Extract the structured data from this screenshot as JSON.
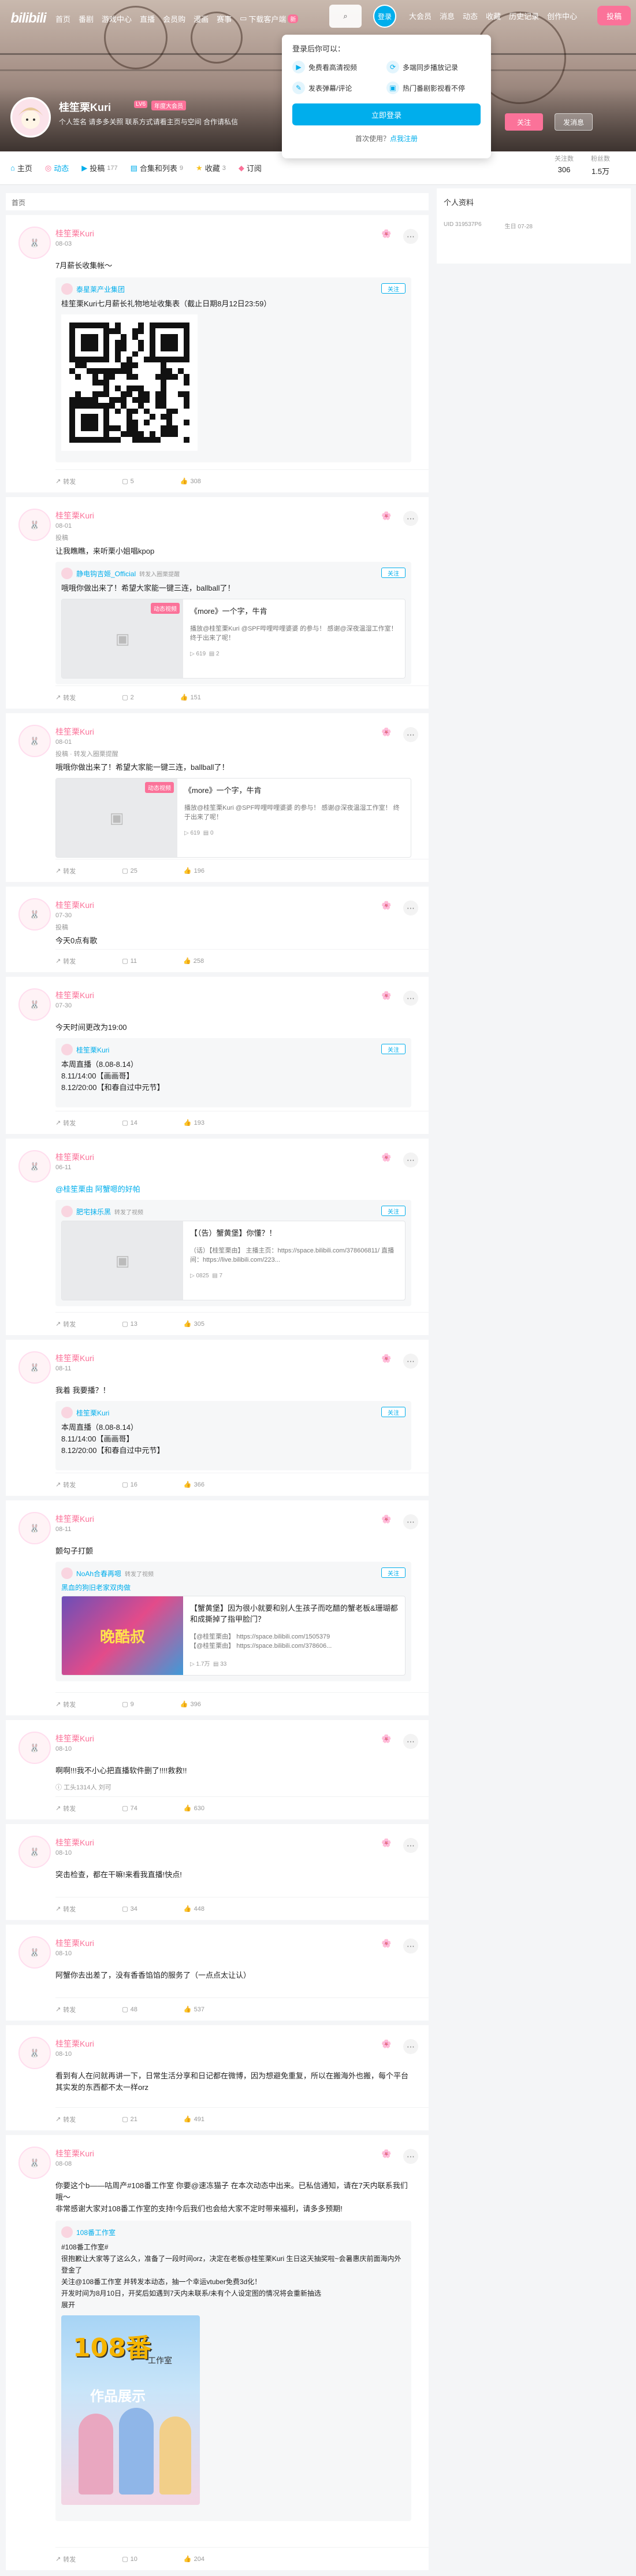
{
  "header": {
    "logo": "bilibili",
    "nav": [
      "首页",
      "番剧",
      "游戏中心",
      "直播",
      "会员购",
      "漫画",
      "赛事"
    ],
    "download": "下载客户端",
    "download_badge": "新",
    "login": "登录",
    "right_nav": [
      "大会员",
      "消息",
      "动态",
      "收藏",
      "历史记录",
      "创作中心"
    ],
    "post": "投稿"
  },
  "profile": {
    "name": "桂笙栗Kuri",
    "level": "LV6",
    "vip": "年度大会员",
    "sign": "个人签名 请多多关照 联系方式请看主页与空间 合作请私信",
    "follow": "关注",
    "message": "发消息",
    "stats": [
      {
        "label": "关注数",
        "value": "306"
      },
      {
        "label": "粉丝数",
        "value": "1.5万"
      }
    ]
  },
  "login_popup": {
    "title": "登录后你可以：",
    "features": [
      "免费看高清视频",
      "多端同步播放记录",
      "发表弹幕/评论",
      "热门番剧影视看不停"
    ],
    "button": "立即登录",
    "first_prefix": "首次使用？",
    "first_link": "点我注册"
  },
  "tabs": [
    {
      "label": "主页",
      "count": ""
    },
    {
      "label": "动态",
      "count": ""
    },
    {
      "label": "投稿",
      "count": "177"
    },
    {
      "label": "合集和列表",
      "count": "9"
    },
    {
      "label": "收藏",
      "count": "3"
    },
    {
      "label": "订阅",
      "count": ""
    }
  ],
  "breadcrumb": "首页",
  "side": {
    "title": "个人资料",
    "uid": "UID 319537P6",
    "birth": "生日 07-28"
  },
  "cards": [
    {
      "name": "桂笙栗Kuri",
      "date": "08-03",
      "text": "7月薪长收集帐～",
      "quote_name": "泰星莱产业集团",
      "quote_btn": "关注",
      "quote_text": "桂笙栗Kuri七月薪长礼物地址收集表（截止日期8月12日23:59）",
      "actions": [
        "转发",
        "5",
        "308"
      ]
    },
    {
      "name": "桂笙栗Kuri",
      "date": "08-01",
      "sub": "投稿",
      "text": "让我瞧瞧，来听栗小姐唱kpop",
      "quote_name": "静电钩吉姬_Official",
      "quote_note": "转发入圈栗提醒",
      "quote_btn": "关注",
      "quote_text": "哦哦你做出来了！希望大家能一键三连，ballball了！",
      "vtag": "动态视频",
      "vtitle": "《more》一个字，牛肯",
      "vdesc": "播放@桂笙栗Kuri @SPF哔哩哔哩婆婆 的参与！ 感谢@深夜温湿工作室！ 终于出来了呢！",
      "vstats": [
        "619",
        "2"
      ],
      "actions": [
        "转发",
        "2",
        "151"
      ]
    },
    {
      "name": "桂笙栗Kuri",
      "date": "08-01",
      "sub": "投稿 · 转发入圈栗提醒",
      "text": "哦哦你做出来了！希望大家能一键三连，ballball了！",
      "vtag": "动态视频",
      "vtitle": "《more》一个字，牛肯",
      "vdesc": "播放@桂笙栗Kuri @SPF哔哩哔哩婆婆 的参与！ 感谢@深夜温湿工作室！ 终于出来了呢！",
      "vstats": [
        "619",
        "0"
      ],
      "actions": [
        "转发",
        "25",
        "196"
      ]
    },
    {
      "name": "桂笙栗Kuri",
      "date": "07-30",
      "sub": "投稿",
      "text": "今天0点有歌",
      "actions": [
        "转发",
        "11",
        "258"
      ]
    },
    {
      "name": "桂笙栗Kuri",
      "date": "07-30",
      "text": "今天时间更改为19:00",
      "quote_name": "桂笙栗Kuri",
      "quote_btn": "关注",
      "quote_text": "本周直播（8.08-8.14）\n8.11/14:00【画画哥】\n8.12/20:00【和春自过中元节】",
      "actions": [
        "转发",
        "14",
        "193"
      ]
    },
    {
      "name": "桂笙栗Kuri",
      "date": "06-11",
      "text": "@桂笙栗由 阿蟹嗯的好帕",
      "quote_name": "肥宅抹乐黑",
      "quote_note": "转发了视频",
      "quote_btn": "关注",
      "vtitle": "【（告）蟹黄堡】你懂？！",
      "vdesc": "（话）【桂笙栗由】 主播主页：https://space.bilibili.com/378606811/ 直播间：https://live.bilibili.com/223...",
      "vstats": [
        "0825",
        "7"
      ],
      "actions": [
        "转发",
        "13",
        "305"
      ]
    },
    {
      "name": "桂笙栗Kuri",
      "date": "08-11",
      "text": "我着 我要播？！",
      "quote_name": "桂笙栗Kuri",
      "quote_btn": "关注",
      "quote_text": "本周直播（8.08-8.14）\n8.11/14:00【画画哥】\n8.12/20:00【和春自过中元节】",
      "actions": [
        "转发",
        "16",
        "366"
      ]
    },
    {
      "name": "桂笙栗Kuri",
      "date": "08-11",
      "text": "颤勾子打颤",
      "quote_name": "NoAh合春再嗯",
      "quote_note": "转发了视频",
      "quote_btn": "关注",
      "quote_sub": "黑血的狗旧老家双肉做",
      "vtitle": "【蟹黄堡】因为很小就要和别人生孩子而吃醋的蟹老板&珊瑚都和成撕掉了指甲脸门？",
      "vdesc": "【@桂笙栗由】 https://space.bilibili.com/1505379\n【@桂笙栗由】 https://space.bilibili.com/378606...",
      "vthumb_text": "晚酷叔",
      "vstats": [
        "1.7万",
        "33"
      ],
      "actions": [
        "转发",
        "9",
        "396"
      ]
    },
    {
      "name": "桂笙栗Kuri",
      "date": "08-10",
      "text": "啊啊!!!我不小心把直播软件删了!!!!救救!!",
      "note": "工头1314人 刘可",
      "actions": [
        "转发",
        "74",
        "630"
      ]
    },
    {
      "name": "桂笙栗Kuri",
      "date": "08-10",
      "text": "突击检查，都在干嘛!来看我直播!快点!",
      "actions": [
        "转发",
        "34",
        "448"
      ]
    },
    {
      "name": "桂笙栗Kuri",
      "date": "08-10",
      "text": "阿蟹你去出差了，没有香香馅馅的服务了（一点点太让认）",
      "actions": [
        "转发",
        "48",
        "537"
      ]
    },
    {
      "name": "桂笙栗Kuri",
      "date": "08-10",
      "text": "看到有人在问就再讲一下，日常生活分享和日记都在微博，因为想避免重复，所以在搬海外也搬，每个平台其实发的东西都不太一样orz",
      "actions": [
        "转发",
        "21",
        "491"
      ]
    },
    {
      "name": "桂笙栗Kuri",
      "date": "08-08",
      "text": "你要这个b——咕周产#108番工作室 你要@速冻猫子 在本次动态中出来。已私信通知，请在7天内联系我们哦～\n非常感谢大家对108番工作室的支持!今后我们也会给大家不定时带来福利，请多多预期!",
      "quote_name": "108番工作室",
      "quote_text": "#108番工作室#\n很抱歉让大家等了这么久，准备了一段时间orz，决定在老板@桂笙栗Kuri 生日这天抽奖啦~会暑惠庆前面海内外登金了\n关注@108番工作室 并转发本动态，抽一个幸运vtuber免费3d化！\n开发时间为8月10日，开奖后如遇到7天内未联系/未有个人设定图的情况将会重新抽选\n展开",
      "ill_title": "108番",
      "ill_sub": "工作室",
      "ill_caption": "作品展示",
      "actions": [
        "转发",
        "10",
        "204"
      ]
    }
  ]
}
